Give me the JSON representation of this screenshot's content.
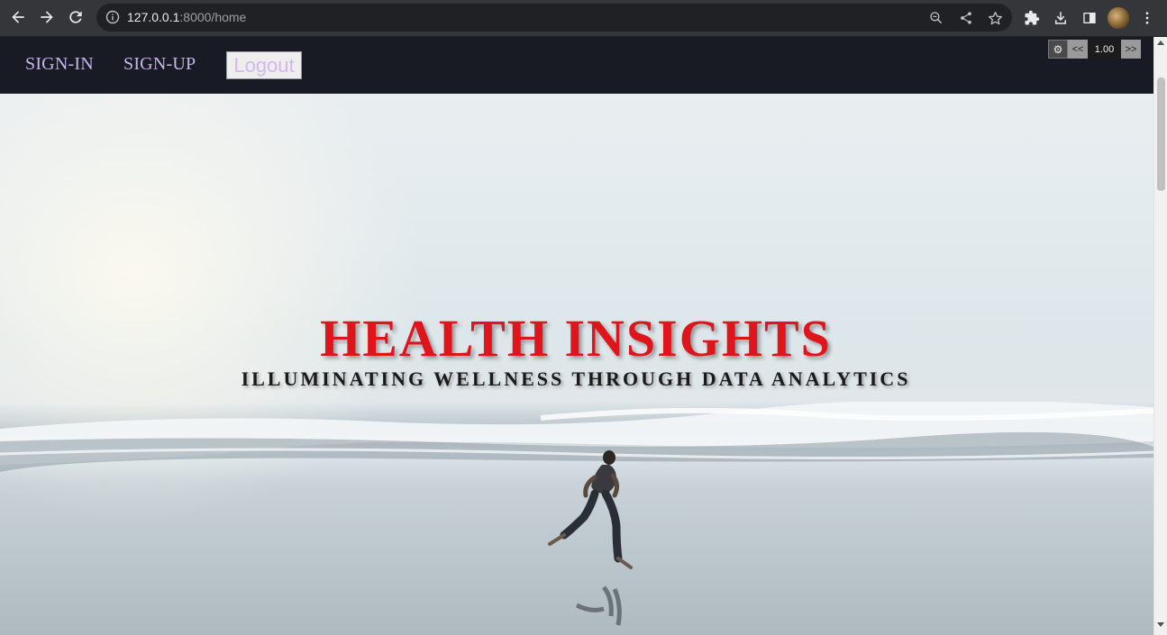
{
  "browser": {
    "url_host": "127.0.0.1",
    "url_rest": ":8000/home",
    "icons": [
      "back-icon",
      "forward-icon",
      "reload-icon",
      "info-icon",
      "zoom-icon",
      "share-icon",
      "star-icon",
      "extensions-icon",
      "download-icon",
      "sidebar-icon",
      "avatar",
      "menu-icon"
    ]
  },
  "nav": {
    "signin_label": "SIGN-IN",
    "signup_label": "SIGN-UP",
    "logout_label": "Logout"
  },
  "speed": {
    "gear": "⚙",
    "prev": "<<",
    "value": "1.00",
    "next": ">>"
  },
  "hero": {
    "title": "HEALTH INSIGHTS",
    "subtitle": "ILLUMINATING WELLNESS THROUGH DATA ANALYTICS"
  },
  "colors": {
    "nav_bg": "#181a24",
    "nav_link": "#c5b7e8",
    "title": "#e0151b",
    "subtitle": "#1a1a1a"
  }
}
